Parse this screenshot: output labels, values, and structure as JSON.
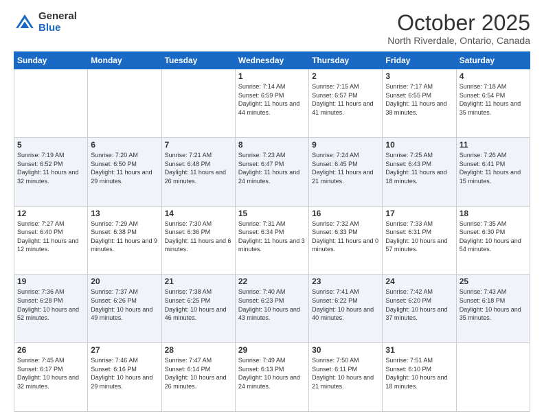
{
  "logo": {
    "general": "General",
    "blue": "Blue"
  },
  "header": {
    "month": "October 2025",
    "location": "North Riverdale, Ontario, Canada"
  },
  "weekdays": [
    "Sunday",
    "Monday",
    "Tuesday",
    "Wednesday",
    "Thursday",
    "Friday",
    "Saturday"
  ],
  "weeks": [
    [
      {
        "day": "",
        "info": ""
      },
      {
        "day": "",
        "info": ""
      },
      {
        "day": "",
        "info": ""
      },
      {
        "day": "1",
        "info": "Sunrise: 7:14 AM\nSunset: 6:59 PM\nDaylight: 11 hours and 44 minutes."
      },
      {
        "day": "2",
        "info": "Sunrise: 7:15 AM\nSunset: 6:57 PM\nDaylight: 11 hours and 41 minutes."
      },
      {
        "day": "3",
        "info": "Sunrise: 7:17 AM\nSunset: 6:55 PM\nDaylight: 11 hours and 38 minutes."
      },
      {
        "day": "4",
        "info": "Sunrise: 7:18 AM\nSunset: 6:54 PM\nDaylight: 11 hours and 35 minutes."
      }
    ],
    [
      {
        "day": "5",
        "info": "Sunrise: 7:19 AM\nSunset: 6:52 PM\nDaylight: 11 hours and 32 minutes."
      },
      {
        "day": "6",
        "info": "Sunrise: 7:20 AM\nSunset: 6:50 PM\nDaylight: 11 hours and 29 minutes."
      },
      {
        "day": "7",
        "info": "Sunrise: 7:21 AM\nSunset: 6:48 PM\nDaylight: 11 hours and 26 minutes."
      },
      {
        "day": "8",
        "info": "Sunrise: 7:23 AM\nSunset: 6:47 PM\nDaylight: 11 hours and 24 minutes."
      },
      {
        "day": "9",
        "info": "Sunrise: 7:24 AM\nSunset: 6:45 PM\nDaylight: 11 hours and 21 minutes."
      },
      {
        "day": "10",
        "info": "Sunrise: 7:25 AM\nSunset: 6:43 PM\nDaylight: 11 hours and 18 minutes."
      },
      {
        "day": "11",
        "info": "Sunrise: 7:26 AM\nSunset: 6:41 PM\nDaylight: 11 hours and 15 minutes."
      }
    ],
    [
      {
        "day": "12",
        "info": "Sunrise: 7:27 AM\nSunset: 6:40 PM\nDaylight: 11 hours and 12 minutes."
      },
      {
        "day": "13",
        "info": "Sunrise: 7:29 AM\nSunset: 6:38 PM\nDaylight: 11 hours and 9 minutes."
      },
      {
        "day": "14",
        "info": "Sunrise: 7:30 AM\nSunset: 6:36 PM\nDaylight: 11 hours and 6 minutes."
      },
      {
        "day": "15",
        "info": "Sunrise: 7:31 AM\nSunset: 6:34 PM\nDaylight: 11 hours and 3 minutes."
      },
      {
        "day": "16",
        "info": "Sunrise: 7:32 AM\nSunset: 6:33 PM\nDaylight: 11 hours and 0 minutes."
      },
      {
        "day": "17",
        "info": "Sunrise: 7:33 AM\nSunset: 6:31 PM\nDaylight: 10 hours and 57 minutes."
      },
      {
        "day": "18",
        "info": "Sunrise: 7:35 AM\nSunset: 6:30 PM\nDaylight: 10 hours and 54 minutes."
      }
    ],
    [
      {
        "day": "19",
        "info": "Sunrise: 7:36 AM\nSunset: 6:28 PM\nDaylight: 10 hours and 52 minutes."
      },
      {
        "day": "20",
        "info": "Sunrise: 7:37 AM\nSunset: 6:26 PM\nDaylight: 10 hours and 49 minutes."
      },
      {
        "day": "21",
        "info": "Sunrise: 7:38 AM\nSunset: 6:25 PM\nDaylight: 10 hours and 46 minutes."
      },
      {
        "day": "22",
        "info": "Sunrise: 7:40 AM\nSunset: 6:23 PM\nDaylight: 10 hours and 43 minutes."
      },
      {
        "day": "23",
        "info": "Sunrise: 7:41 AM\nSunset: 6:22 PM\nDaylight: 10 hours and 40 minutes."
      },
      {
        "day": "24",
        "info": "Sunrise: 7:42 AM\nSunset: 6:20 PM\nDaylight: 10 hours and 37 minutes."
      },
      {
        "day": "25",
        "info": "Sunrise: 7:43 AM\nSunset: 6:18 PM\nDaylight: 10 hours and 35 minutes."
      }
    ],
    [
      {
        "day": "26",
        "info": "Sunrise: 7:45 AM\nSunset: 6:17 PM\nDaylight: 10 hours and 32 minutes."
      },
      {
        "day": "27",
        "info": "Sunrise: 7:46 AM\nSunset: 6:16 PM\nDaylight: 10 hours and 29 minutes."
      },
      {
        "day": "28",
        "info": "Sunrise: 7:47 AM\nSunset: 6:14 PM\nDaylight: 10 hours and 26 minutes."
      },
      {
        "day": "29",
        "info": "Sunrise: 7:49 AM\nSunset: 6:13 PM\nDaylight: 10 hours and 24 minutes."
      },
      {
        "day": "30",
        "info": "Sunrise: 7:50 AM\nSunset: 6:11 PM\nDaylight: 10 hours and 21 minutes."
      },
      {
        "day": "31",
        "info": "Sunrise: 7:51 AM\nSunset: 6:10 PM\nDaylight: 10 hours and 18 minutes."
      },
      {
        "day": "",
        "info": ""
      }
    ]
  ]
}
